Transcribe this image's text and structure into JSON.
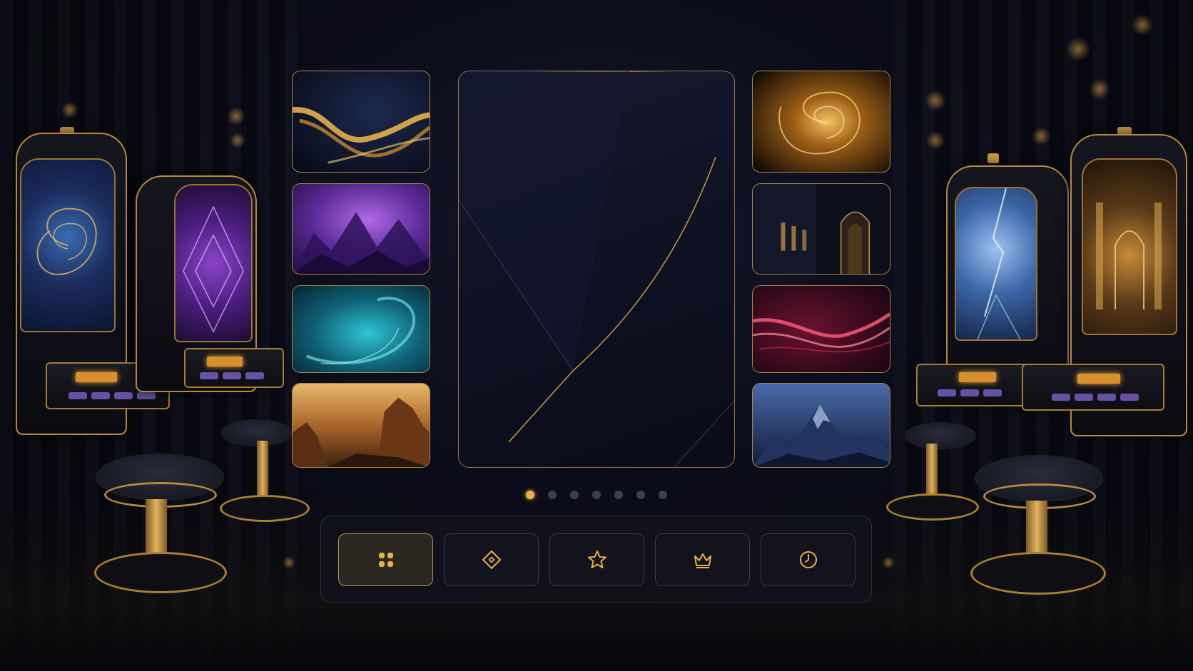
{
  "gallery": {
    "left_thumbnails": [
      {
        "theme": "golden-wave-night"
      },
      {
        "theme": "purple-mountains"
      },
      {
        "theme": "teal-vortex"
      },
      {
        "theme": "desert-canyon"
      }
    ],
    "right_thumbnails": [
      {
        "theme": "golden-swirl"
      },
      {
        "theme": "dark-archway-hall"
      },
      {
        "theme": "crimson-silk-waves"
      },
      {
        "theme": "blue-mountain-peak"
      }
    ],
    "main_card": {
      "theme": "dark-navy-gold-lines"
    }
  },
  "pagination": {
    "total": 7,
    "active_index": 0
  },
  "nav": {
    "items": [
      {
        "icon": "grid-icon",
        "active": true
      },
      {
        "icon": "diamond-icon",
        "active": false
      },
      {
        "icon": "star-icon",
        "active": false
      },
      {
        "icon": "crown-icon",
        "active": false
      },
      {
        "icon": "clock-icon",
        "active": false
      }
    ]
  },
  "colors": {
    "accent_gold": "#e9b24b",
    "background": "#0b0c18",
    "inactive_dot": "#3b3e55"
  }
}
